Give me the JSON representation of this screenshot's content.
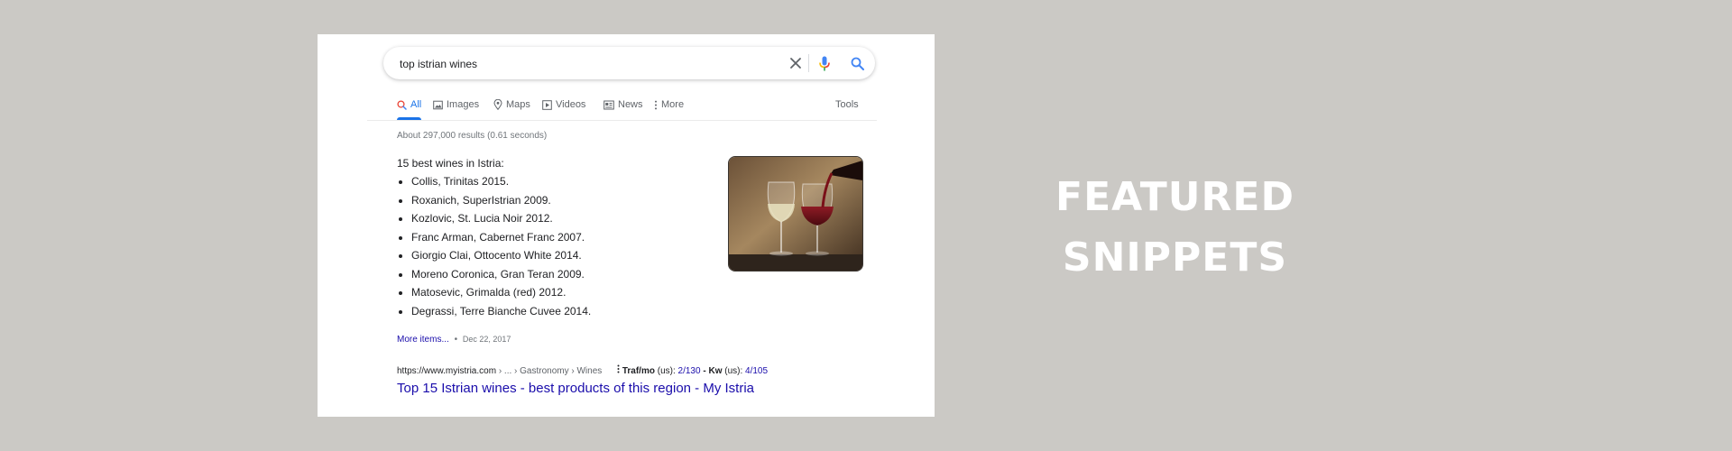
{
  "search": {
    "query": "top istrian wines",
    "clear_icon": "close-icon",
    "mic_icon": "microphone-icon",
    "search_icon": "search-icon"
  },
  "tabs": [
    {
      "label": "All",
      "icon": "search-icon",
      "active": true
    },
    {
      "label": "Images",
      "icon": "image-icon"
    },
    {
      "label": "Maps",
      "icon": "map-pin-icon"
    },
    {
      "label": "Videos",
      "icon": "video-icon"
    },
    {
      "label": "News",
      "icon": "news-icon"
    },
    {
      "label": "More",
      "icon": "more-vert-icon"
    }
  ],
  "tools_label": "Tools",
  "stats": "About 297,000 results (0.61 seconds)",
  "snippet": {
    "title": "15 best wines in Istria:",
    "items": [
      "Collis, Trinitas 2015.",
      "Roxanich, SuperIstrian 2009.",
      "Kozlovic, St. Lucia Noir 2012.",
      "Franc Arman, Cabernet Franc 2007.",
      "Giorgio Clai, Ottocento White 2014.",
      "Moreno Coronica, Gran Teran 2009.",
      "Matosevic, Grimalda (red) 2012.",
      "Degrassi, Terre Bianche Cuvee 2014."
    ],
    "more_link": "More items...",
    "separator": "•",
    "date": "Dec 22, 2017"
  },
  "result": {
    "url": "https://www.myistria.com",
    "breadcrumb": "› ... › Gastronomy › Wines",
    "seo_traffic_label": "Traf/mo",
    "seo_us_1": "(us):",
    "seo_traffic_value": "2/130",
    "seo_dash": "-",
    "seo_kw_label": "Kw",
    "seo_us_2": "(us):",
    "seo_kw_value": "4/105",
    "title": "Top 15 Istrian wines - best products of this region - My Istria"
  },
  "overlay": {
    "line1": "FEATURED",
    "line2": "SNIPPETS"
  },
  "colors": {
    "background": "#cbc9c5",
    "link": "#1a0dab",
    "active_tab": "#1a73e8"
  }
}
